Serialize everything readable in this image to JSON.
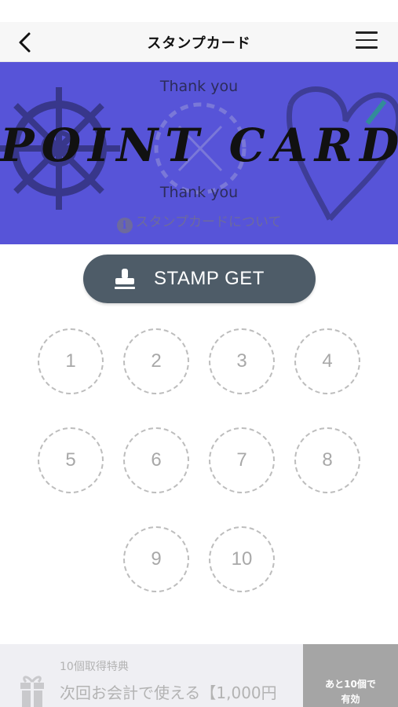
{
  "nav": {
    "title": "スタンプカード"
  },
  "banner": {
    "thank_you_top": "Thank you",
    "title": "POINT CARD",
    "thank_you_bottom": "Thank you",
    "about_link": "スタンプカードについて",
    "background_color": "#5754d8"
  },
  "stamp_button": {
    "label": "STAMP GET",
    "icon": "stamp-icon",
    "color": "#4e5c68"
  },
  "stamps": [
    "1",
    "2",
    "3",
    "4",
    "5",
    "6",
    "7",
    "8",
    "9",
    "10"
  ],
  "footer": {
    "reward_label": "10個取得特典",
    "reward_text": "次回お会計で使える【1,000円",
    "remaining_line1": "あと10個で",
    "remaining_line2": "有効",
    "icon": "gift-icon"
  }
}
